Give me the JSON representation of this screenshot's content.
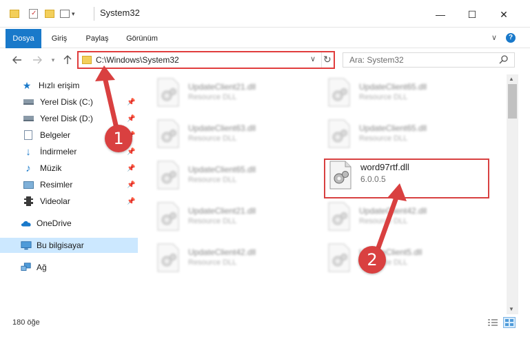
{
  "window": {
    "title": "System32",
    "minimize": "—",
    "maximize": "☐",
    "close": "✕"
  },
  "ribbon": {
    "tabs": [
      "Dosya",
      "Giriş",
      "Paylaş",
      "Görünüm"
    ],
    "collapse": "∨",
    "help": "?"
  },
  "nav": {
    "address": "C:\\Windows\\System32",
    "search_placeholder": "Ara: System32"
  },
  "sidebar": {
    "items": [
      {
        "label": "Hızlı erişim",
        "icon": "star-icon"
      },
      {
        "label": "Yerel Disk (C:)",
        "icon": "drive-icon",
        "pinned": true
      },
      {
        "label": "Yerel Disk (D:)",
        "icon": "drive-icon",
        "pinned": true
      },
      {
        "label": "Belgeler",
        "icon": "documents-icon",
        "pinned": true
      },
      {
        "label": "İndirmeler",
        "icon": "downloads-icon",
        "pinned": true
      },
      {
        "label": "Müzik",
        "icon": "music-icon",
        "pinned": true
      },
      {
        "label": "Resimler",
        "icon": "pictures-icon",
        "pinned": true
      },
      {
        "label": "Videolar",
        "icon": "videos-icon",
        "pinned": true
      },
      {
        "label": "OneDrive",
        "icon": "onedrive-icon"
      },
      {
        "label": "Bu bilgisayar",
        "icon": "computer-icon",
        "selected": true
      },
      {
        "label": "Ağ",
        "icon": "network-icon"
      }
    ]
  },
  "files": [
    {
      "name": "UpdateClient21.dll",
      "desc": "Resource DLL"
    },
    {
      "name": "UpdateClient65.dll",
      "desc": "Resource DLL"
    },
    {
      "name": "UpdateClient63.dll",
      "desc": "Resource DLL"
    },
    {
      "name": "UpdateClient65.dll",
      "desc": "Resource DLL"
    },
    {
      "name": "UpdateClient65.dll",
      "desc": "Resource DLL"
    },
    {
      "name": "word97rtf.dll",
      "desc": "6.0.0.5"
    },
    {
      "name": "UpdateClient21.dll",
      "desc": "Resource DLL"
    },
    {
      "name": "UpdateClient42.dll",
      "desc": "Resource DLL"
    },
    {
      "name": "UpdateClient42.dll",
      "desc": "Resource DLL"
    },
    {
      "name": "UpdateClient5.dll",
      "desc": "Resource DLL"
    }
  ],
  "status": {
    "count": "180 öğe"
  },
  "annotations": {
    "step1": "1",
    "step2": "2"
  }
}
